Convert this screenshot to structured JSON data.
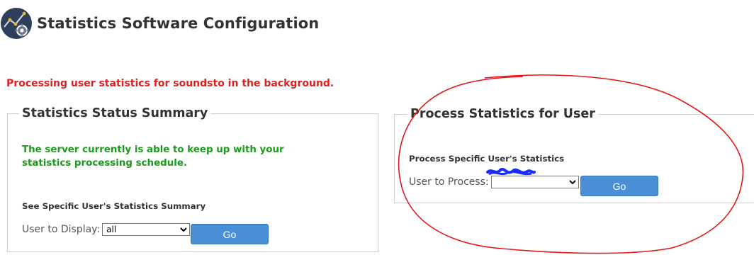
{
  "header": {
    "title": "Statistics Software Configuration",
    "logo_icon": "stats-gear-icon"
  },
  "notice": {
    "text": "Processing user statistics for soundsto in the background.",
    "color": "#e02020"
  },
  "status_summary": {
    "legend": "Statistics Status Summary",
    "message": "The server currently is able to keep up with your statistics processing schedule.",
    "message_color": "#1a9a1a",
    "sub_heading": "See Specific User's Statistics Summary",
    "field_label": "User to Display:",
    "selected_value": "all",
    "go_label": "Go"
  },
  "process_stats": {
    "legend": "Process Statistics for User",
    "sub_heading": "Process Specific User's Statistics",
    "field_label": "User to Process:",
    "selected_value": "",
    "go_label": "Go"
  },
  "colors": {
    "button": "#4a8fd6",
    "annotation": "#e01818",
    "redaction": "#1a2cff"
  }
}
